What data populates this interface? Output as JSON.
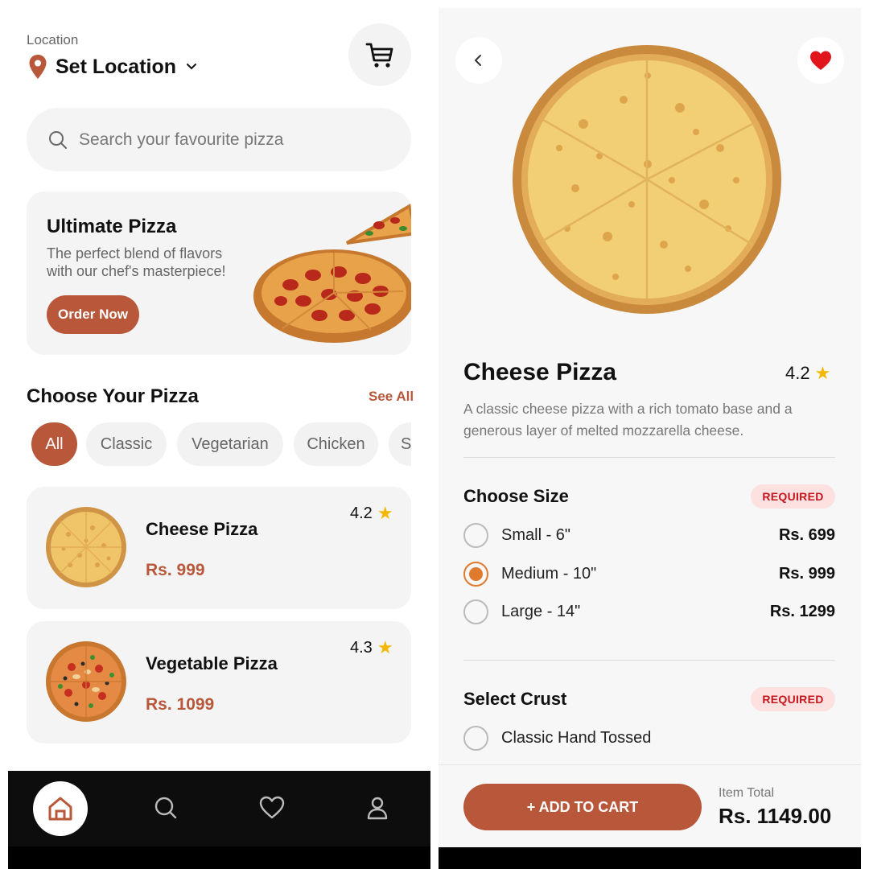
{
  "home": {
    "location_label": "Location",
    "location_value": "Set Location",
    "search_placeholder": "Search your favourite pizza",
    "promo": {
      "title": "Ultimate Pizza",
      "description": "The perfect blend of flavors with our chef's masterpiece!",
      "button": "Order Now"
    },
    "section_title": "Choose Your Pizza",
    "see_all": "See All",
    "categories": [
      {
        "label": "All",
        "active": true
      },
      {
        "label": "Classic",
        "active": false
      },
      {
        "label": "Vegetarian",
        "active": false
      },
      {
        "label": "Chicken",
        "active": false
      },
      {
        "label": "S",
        "active": false
      }
    ],
    "pizzas": [
      {
        "name": "Cheese Pizza",
        "price": "Rs. 999",
        "rating": "4.2"
      },
      {
        "name": "Vegetable Pizza",
        "price": "Rs. 1099",
        "rating": "4.3"
      }
    ],
    "nav": [
      "home-icon",
      "search-icon",
      "heart-icon",
      "profile-icon"
    ]
  },
  "detail": {
    "title": "Cheese Pizza",
    "rating": "4.2",
    "description": "A classic cheese pizza with a rich tomato base and a generous layer of melted mozzarella cheese.",
    "size_section": {
      "title": "Choose Size",
      "badge": "REQUIRED",
      "options": [
        {
          "label": "Small - 6\"",
          "price": "Rs. 699",
          "selected": false
        },
        {
          "label": "Medium - 10\"",
          "price": "Rs. 999",
          "selected": true
        },
        {
          "label": "Large - 14\"",
          "price": "Rs. 1299",
          "selected": false
        }
      ]
    },
    "crust_section": {
      "title": "Select Crust",
      "badge": "REQUIRED",
      "options": [
        {
          "label": "Classic Hand Tossed",
          "selected": false
        }
      ]
    },
    "add_to_cart": "+ ADD TO CART",
    "total_label": "Item Total",
    "total_value": "Rs. 1149.00"
  },
  "colors": {
    "accent": "#b8573a",
    "radio_selected": "#e07b2e",
    "star": "#f5b800",
    "required_bg": "#fde0e0",
    "required_text": "#c4161c",
    "heart": "#e0161c",
    "nav_bg": "#0e0d0d"
  }
}
